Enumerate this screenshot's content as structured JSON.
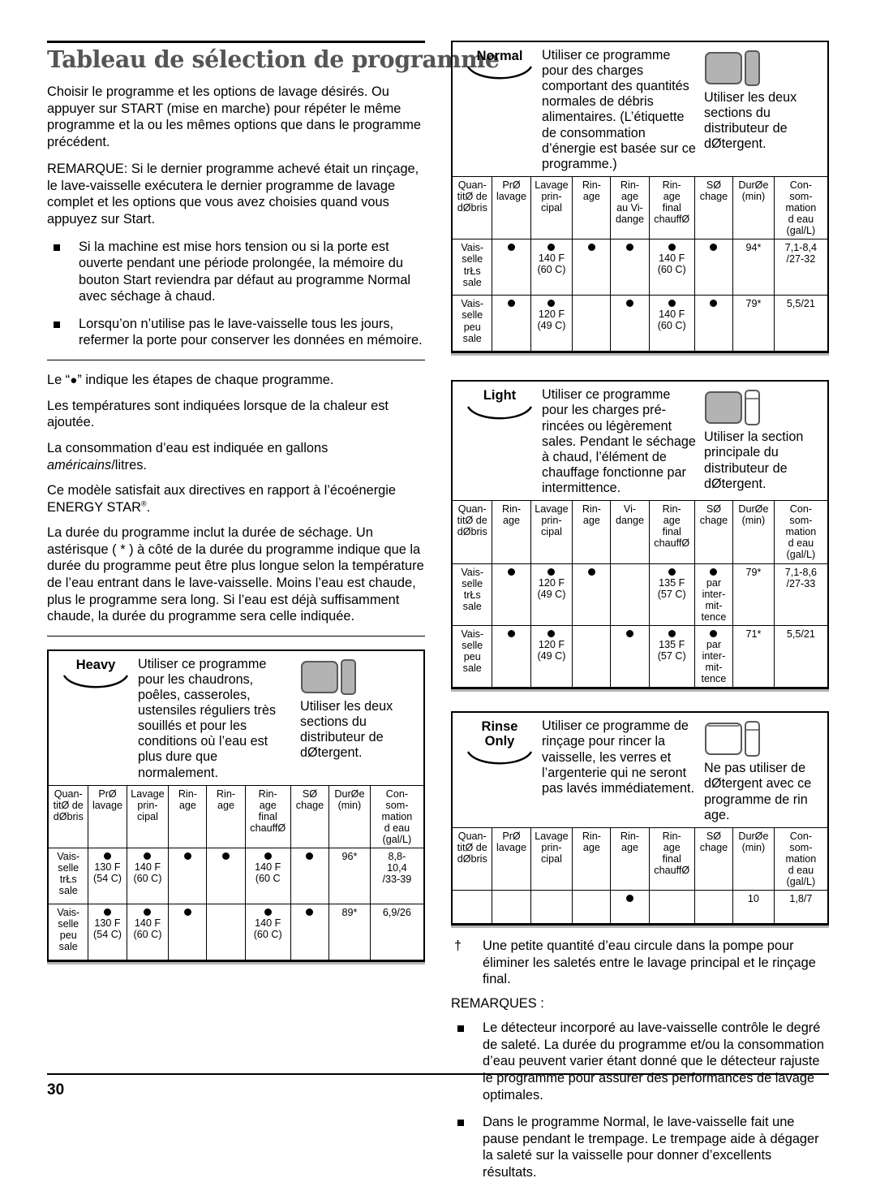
{
  "document": {
    "title": "Tableau de sélection de programme",
    "page_number": "30"
  },
  "intro": {
    "p1": "Choisir le programme et les options de lavage désirés.  Ou appuyer sur START (mise en marche) pour répéter le même programme et la ou les mêmes options que dans le programme précédent.",
    "p2": "REMARQUE:  Si le dernier programme achevé était un rinçage, le lave-vaisselle exécutera le dernier programme de lavage complet et les options que vous avez choisies quand vous appuyez sur Start.",
    "bullets": [
      "Si la machine est mise hors tension ou si la porte est ouverte pendant une période prolongée, la mémoire du bouton Start reviendra par défaut au programme Normal avec séchage à chaud.",
      "Lorsqu’on n’utilise pas le lave-vaisselle tous les jours, refermer la porte pour conserver les données en mémoire."
    ]
  },
  "legend": {
    "l1_pre": "Le “",
    "l1_post": "” indique les étapes de chaque programme.",
    "l2": "Les températures sont indiquées lorsque de la chaleur est ajoutée.",
    "l3_pre": "La consommation d’eau est indiquée en gallons ",
    "l3_em": "américains",
    "l3_post": "/litres.",
    "l4_pre": "Ce modèle satisfait aux directives en rapport à l’écoénergie ENERGY STAR",
    "l4_sup": "®",
    "l4_post": ".",
    "l5": "La durée du programme inclut la durée de séchage. Un astérisque ( * ) à côté de la durée du programme indique que la durée du programme peut être plus longue selon la température de l’eau entrant dans le lave-vaisselle. Moins l’eau est chaude, plus le programme sera long. Si l’eau est déjà suffisamment chaude, la durée du programme sera celle indiquée."
  },
  "programs": {
    "heavy": {
      "name": "Heavy",
      "description": "Utiliser ce programme pour les chaudrons, poêles, casseroles, ustensiles réguliers très souillés et pour les conditions où l’eau est plus dure que normalement.",
      "dispenser_text": "Utiliser les deux sections du distributeur de dØtergent.",
      "dispenser_fill": "both",
      "headers": [
        "Quan-\ntitØ de\ndØbris",
        "PrØ\nlavage",
        "Lavage\nprin-\ncipal",
        "Rin-\nage",
        "Rin-\nage",
        "Rin-\nage\nfinal\nchauffØ",
        "SØ\nchage",
        "DurØe\n(min)",
        "Con-\nsom-\nmation\nd eau\n(gal/L)"
      ],
      "rows": [
        {
          "label": "Vais-\nselle\ntrŁs\nsale",
          "cells": [
            {
              "dot": true,
              "text": "130 F\n(54  C)"
            },
            {
              "dot": true,
              "text": "140 F\n(60  C)"
            },
            {
              "dot": true,
              "text": ""
            },
            {
              "dot": true,
              "text": ""
            },
            {
              "dot": true,
              "text": "140 F\n(60  C"
            },
            {
              "dot": true,
              "text": ""
            },
            {
              "dot": false,
              "text": "96*"
            },
            {
              "dot": false,
              "text": "8,8-\n10,4\n/33-39"
            }
          ]
        },
        {
          "label": "Vais-\nselle\npeu\nsale",
          "cells": [
            {
              "dot": true,
              "text": "130 F\n(54  C)"
            },
            {
              "dot": true,
              "text": "140 F\n(60  C)"
            },
            {
              "dot": true,
              "text": ""
            },
            {
              "dot": false,
              "text": ""
            },
            {
              "dot": true,
              "text": "140 F\n(60  C)"
            },
            {
              "dot": true,
              "text": ""
            },
            {
              "dot": false,
              "text": "89*"
            },
            {
              "dot": false,
              "text": "6,9/26"
            }
          ]
        }
      ]
    },
    "normal": {
      "name": "Normal",
      "description": "Utiliser ce programme pour des charges comportant des quantités normales de débris alimentaires. (L’étiquette de consommation d’énergie est basée sur ce programme.)",
      "dispenser_text": "Utiliser les deux sections du distributeur de dØtergent.",
      "dispenser_fill": "both",
      "headers": [
        "Quan-\ntitØ de\ndØbris",
        "PrØ\nlavage",
        "Lavage\nprin-\ncipal",
        "Rin-\nage",
        "Rin-\nage\nau Vi-\ndange",
        "Rin-\nage\nfinal\nchauffØ",
        "SØ\nchage",
        "DurØe\n(min)",
        "Con-\nsom-\nmation\nd eau\n(gal/L)"
      ],
      "rows": [
        {
          "label": "Vais-\nselle\ntrŁs\nsale",
          "cells": [
            {
              "dot": true,
              "text": ""
            },
            {
              "dot": true,
              "text": "140 F\n(60  C)"
            },
            {
              "dot": true,
              "text": ""
            },
            {
              "dot": true,
              "text": ""
            },
            {
              "dot": true,
              "text": "140 F\n(60  C)"
            },
            {
              "dot": true,
              "text": ""
            },
            {
              "dot": false,
              "text": "94*"
            },
            {
              "dot": false,
              "text": "7,1-8,4\n/27-32"
            }
          ]
        },
        {
          "label": "Vais-\nselle\npeu\nsale",
          "cells": [
            {
              "dot": true,
              "text": ""
            },
            {
              "dot": true,
              "text": "120 F\n(49  C)"
            },
            {
              "dot": false,
              "text": ""
            },
            {
              "dot": true,
              "text": ""
            },
            {
              "dot": true,
              "text": "140 F\n(60  C)"
            },
            {
              "dot": true,
              "text": ""
            },
            {
              "dot": false,
              "text": "79*"
            },
            {
              "dot": false,
              "text": "5,5/21"
            }
          ]
        }
      ]
    },
    "light": {
      "name": "Light",
      "description": "Utiliser ce programme pour les charges pré-rincées ou légèrement sales. Pendant le séchage à chaud, l’élément de chauffage fonctionne par intermittence.",
      "dispenser_text": "Utiliser la section principale du distributeur de dØtergent.",
      "dispenser_fill": "main",
      "headers": [
        "Quan-\ntitØ de\ndØbris",
        "Rin-\nage",
        "Lavage\nprin-\ncipal",
        "Rin-\nage",
        "Vi-\ndange",
        "Rin-\nage\nfinal\nchauffØ",
        "SØ\nchage",
        "DurØe\n(min)",
        "Con-\nsom-\nmation\nd eau\n(gal/L)"
      ],
      "rows": [
        {
          "label": "Vais-\nselle\ntrŁs\nsale",
          "cells": [
            {
              "dot": true,
              "text": ""
            },
            {
              "dot": true,
              "text": "120 F\n(49  C)"
            },
            {
              "dot": true,
              "text": ""
            },
            {
              "dot": false,
              "text": ""
            },
            {
              "dot": true,
              "text": "135 F\n(57  C)"
            },
            {
              "dot": true,
              "text": "par\ninter-\nmit-\ntence"
            },
            {
              "dot": false,
              "text": "79*"
            },
            {
              "dot": false,
              "text": "7,1-8,6\n/27-33"
            }
          ]
        },
        {
          "label": "Vais-\nselle\npeu\nsale",
          "cells": [
            {
              "dot": true,
              "text": ""
            },
            {
              "dot": true,
              "text": "120 F\n(49  C)"
            },
            {
              "dot": false,
              "text": ""
            },
            {
              "dot": true,
              "text": ""
            },
            {
              "dot": true,
              "text": "135 F\n(57  C)"
            },
            {
              "dot": true,
              "text": "par\ninter-\nmit-\ntence"
            },
            {
              "dot": false,
              "text": "71*"
            },
            {
              "dot": false,
              "text": "5,5/21"
            }
          ]
        }
      ]
    },
    "rinse_only": {
      "name_line1": "Rinse",
      "name_line2": "Only",
      "description": "Utiliser ce programme de rinçage pour rincer la vaisselle, les verres et l’argenterie qui ne seront pas lavés immédiatement.",
      "dispenser_text": "Ne pas utiliser de dØtergent avec ce programme de rin age.",
      "dispenser_fill": "none",
      "headers": [
        "Quan-\ntitØ de\ndØbris",
        "PrØ\nlavage",
        "Lavage\nprin-\ncipal",
        "Rin-\nage",
        "Rin-\nage",
        "Rin-\nage\nfinal\nchauffØ",
        "SØ\nchage",
        "DurØe\n(min)",
        "Con-\nsom-\nmation\nd eau\n(gal/L)"
      ],
      "rows": [
        {
          "label": "",
          "cells": [
            {
              "dot": false,
              "text": ""
            },
            {
              "dot": false,
              "text": ""
            },
            {
              "dot": false,
              "text": ""
            },
            {
              "dot": true,
              "text": ""
            },
            {
              "dot": false,
              "text": ""
            },
            {
              "dot": false,
              "text": ""
            },
            {
              "dot": false,
              "text": "10"
            },
            {
              "dot": false,
              "text": "1,8/7"
            }
          ]
        }
      ]
    }
  },
  "notes": {
    "dagger_symbol": "†",
    "dagger_text": "Une petite quantité d’eau circule dans la pompe pour éliminer les saletés entre le lavage principal et le rinçage final.",
    "remarques_label": "REMARQUES :",
    "bullets": [
      "Le détecteur incorporé au lave-vaisselle contrôle le degré de saleté.  La durée du programme et/ou la consommation d’eau peuvent varier étant donné que le détecteur rajuste le programme pour assurer des performances de lavage optimales.",
      "Dans le programme Normal, le lave-vaisselle fait une pause pendant le trempage. Le trempage aide à dégager la saleté sur la vaisselle pour donner d’excellents résultats."
    ]
  },
  "colors": {
    "title_gray": "#555555",
    "dispenser_fill_gray": "#b3b3b3",
    "rule_black": "#000000"
  }
}
